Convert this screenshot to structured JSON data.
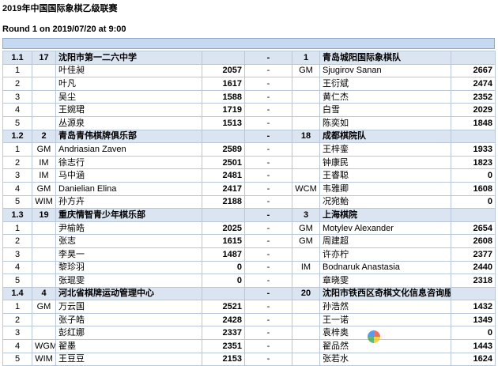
{
  "header": {
    "title": "2019年中国国际象棋乙级联赛",
    "round": "Round 1 on 2019/07/20 at 9:00"
  },
  "matches": [
    {
      "board": "1.1",
      "home_no": "17",
      "home_team": "沈阳市第一二六中学",
      "sep": "-",
      "away_no": "1",
      "away_team": "青岛城阳国际象棋队",
      "games": [
        {
          "no": "1",
          "t1": "",
          "n1": "叶佳昶",
          "r1": "2057",
          "sep": "-",
          "t2": "GM",
          "n2": "Sjugirov Sanan",
          "r2": "2667"
        },
        {
          "no": "2",
          "t1": "",
          "n1": "叶凡",
          "r1": "1617",
          "sep": "-",
          "t2": "",
          "n2": "王衍斌",
          "r2": "2474"
        },
        {
          "no": "3",
          "t1": "",
          "n1": "吴尘",
          "r1": "1588",
          "sep": "-",
          "t2": "",
          "n2": "黄仁杰",
          "r2": "2352"
        },
        {
          "no": "4",
          "t1": "",
          "n1": "王婉珺",
          "r1": "1719",
          "sep": "-",
          "t2": "",
          "n2": "白雪",
          "r2": "2029"
        },
        {
          "no": "5",
          "t1": "",
          "n1": "丛源泉",
          "r1": "1513",
          "sep": "-",
          "t2": "",
          "n2": "陈奕如",
          "r2": "1848"
        }
      ]
    },
    {
      "board": "1.2",
      "home_no": "2",
      "home_team": "青岛青伟棋牌俱乐部",
      "sep": "-",
      "away_no": "18",
      "away_team": "成都棋院队",
      "games": [
        {
          "no": "1",
          "t1": "GM",
          "n1": "Andriasian Zaven",
          "r1": "2589",
          "sep": "-",
          "t2": "",
          "n2": "王梓銮",
          "r2": "1933"
        },
        {
          "no": "2",
          "t1": "IM",
          "n1": "徐志行",
          "r1": "2501",
          "sep": "-",
          "t2": "",
          "n2": "钟康民",
          "r2": "1823"
        },
        {
          "no": "3",
          "t1": "IM",
          "n1": "马中涵",
          "r1": "2481",
          "sep": "-",
          "t2": "",
          "n2": "王睿聪",
          "r2": "0"
        },
        {
          "no": "4",
          "t1": "GM",
          "n1": "Danielian Elina",
          "r1": "2417",
          "sep": "-",
          "t2": "WCM",
          "n2": "韦雅卿",
          "r2": "1608"
        },
        {
          "no": "5",
          "t1": "WIM",
          "n1": "孙方卉",
          "r1": "2188",
          "sep": "-",
          "t2": "",
          "n2": "况宛鲐",
          "r2": "0"
        }
      ]
    },
    {
      "board": "1.3",
      "home_no": "19",
      "home_team": "重庆情智青少年棋乐部",
      "sep": "-",
      "away_no": "3",
      "away_team": "上海棋院",
      "games": [
        {
          "no": "1",
          "t1": "",
          "n1": "尹榆皓",
          "r1": "2025",
          "sep": "-",
          "t2": "GM",
          "n2": "Motylev Alexander",
          "r2": "2654"
        },
        {
          "no": "2",
          "t1": "",
          "n1": "张志",
          "r1": "1615",
          "sep": "-",
          "t2": "GM",
          "n2": "周建超",
          "r2": "2608"
        },
        {
          "no": "3",
          "t1": "",
          "n1": "李昊一",
          "r1": "1487",
          "sep": "-",
          "t2": "",
          "n2": "许亦柠",
          "r2": "2377"
        },
        {
          "no": "4",
          "t1": "",
          "n1": "黎珍羽",
          "r1": "0",
          "sep": "-",
          "t2": "IM",
          "n2": "Bodnaruk Anastasia",
          "r2": "2440"
        },
        {
          "no": "5",
          "t1": "",
          "n1": "张琨雯",
          "r1": "0",
          "sep": "-",
          "t2": "",
          "n2": "章晓雯",
          "r2": "2318"
        }
      ]
    },
    {
      "board": "1.4",
      "home_no": "4",
      "home_team": "河北省棋牌运动管理中心",
      "sep": "-",
      "away_no": "20",
      "away_team": "沈阳市铁西区奇棋文化信息咨询服务中心",
      "games": [
        {
          "no": "1",
          "t1": "GM",
          "n1": "万云国",
          "r1": "2521",
          "sep": "-",
          "t2": "",
          "n2": "孙浩然",
          "r2": "1432"
        },
        {
          "no": "2",
          "t1": "",
          "n1": "张子皓",
          "r1": "2428",
          "sep": "-",
          "t2": "",
          "n2": "王一诺",
          "r2": "1349"
        },
        {
          "no": "3",
          "t1": "",
          "n1": "彭红娜",
          "r1": "2337",
          "sep": "-",
          "t2": "",
          "n2": "袁梓奥",
          "r2": "0"
        },
        {
          "no": "4",
          "t1": "WGM",
          "n1": "翟墨",
          "r1": "2351",
          "sep": "-",
          "t2": "",
          "n2": "翟品然",
          "r2": "1443"
        },
        {
          "no": "5",
          "t1": "WIM",
          "n1": "王豆豆",
          "r1": "2153",
          "sep": "-",
          "t2": "",
          "n2": "张若水",
          "r2": "1624"
        }
      ]
    }
  ],
  "watermark": {
    "text": ""
  }
}
